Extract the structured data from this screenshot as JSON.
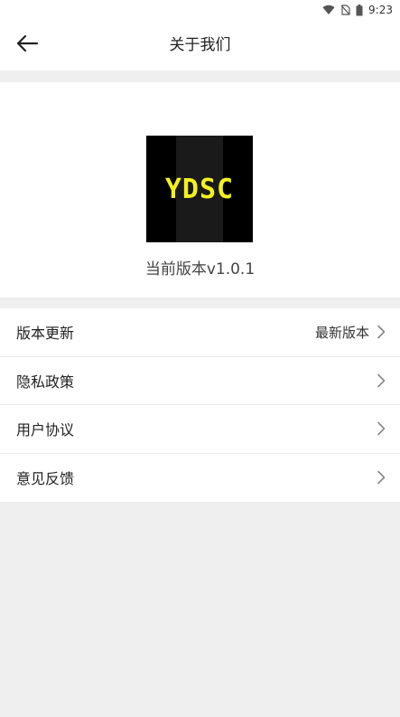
{
  "status_bar": {
    "time": "9:23",
    "icons": [
      "wifi-icon",
      "no-sim-icon",
      "battery-icon"
    ]
  },
  "nav": {
    "title": "关于我们",
    "back_icon": "back-arrow-icon"
  },
  "hero": {
    "logo_text": "YDSC",
    "version_text": "当前版本v1.0.1"
  },
  "menu": {
    "items": [
      {
        "label": "版本更新",
        "value": "最新版本"
      },
      {
        "label": "隐私政策",
        "value": ""
      },
      {
        "label": "用户协议",
        "value": ""
      },
      {
        "label": "意见反馈",
        "value": ""
      }
    ]
  },
  "colors": {
    "page_background": "#efefef",
    "card_background": "#ffffff",
    "logo_background": "#000000",
    "logo_text": "#f2f21c"
  }
}
